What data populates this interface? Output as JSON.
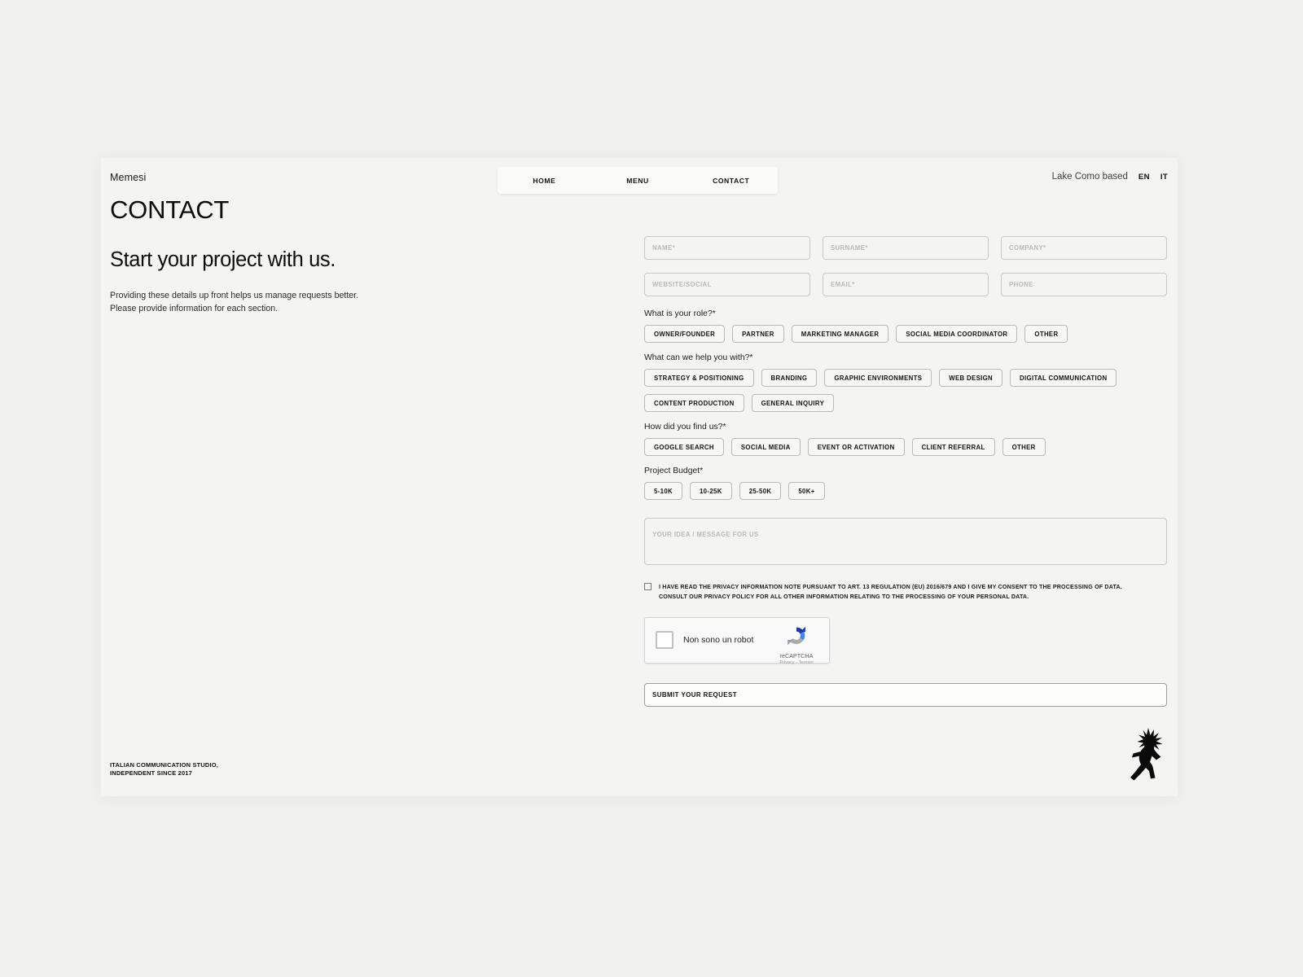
{
  "header": {
    "brand": "Memesi",
    "nav": [
      {
        "label": "HOME"
      },
      {
        "label": "MENU"
      },
      {
        "label": "CONTACT"
      }
    ],
    "location": "Lake Como based",
    "lang_en": "EN",
    "lang_it": "IT"
  },
  "hero": {
    "page_title": "CONTACT",
    "headline": "Start your project with us.",
    "sub_line_1": "Providing these details up front helps us manage requests better.",
    "sub_line_2": "Please provide information for each section."
  },
  "form": {
    "fields_row_1": [
      {
        "placeholder": "NAME*",
        "value": ""
      },
      {
        "placeholder": "SURNAME*",
        "value": ""
      },
      {
        "placeholder": "COMPANY*",
        "value": ""
      }
    ],
    "fields_row_2": [
      {
        "placeholder": "WEBSITE/SOCIAL",
        "value": ""
      },
      {
        "placeholder": "EMAIL*",
        "value": ""
      },
      {
        "placeholder": "PHONE",
        "value": ""
      }
    ],
    "role": {
      "label": "What is your role?*",
      "options": [
        "OWNER/FOUNDER",
        "PARTNER",
        "MARKETING MANAGER",
        "SOCIAL MEDIA COORDINATOR",
        "OTHER"
      ]
    },
    "help": {
      "label": "What can we help you with?*",
      "options": [
        "STRATEGY & POSITIONING",
        "BRANDING",
        "GRAPHIC ENVIRONMENTS",
        "WEB DESIGN",
        "DIGITAL COMMUNICATION",
        "CONTENT PRODUCTION",
        "GENERAL INQUIRY"
      ]
    },
    "source": {
      "label": "How did you find us?*",
      "options": [
        "GOOGLE SEARCH",
        "SOCIAL MEDIA",
        "EVENT OR ACTIVATION",
        "CLIENT REFERRAL",
        "OTHER"
      ]
    },
    "budget": {
      "label": "Project Budget*",
      "options": [
        "5-10K",
        "10-25K",
        "25-50K",
        "50K+"
      ]
    },
    "message": {
      "placeholder": "YOUR IDEA / MESSAGE FOR US",
      "value": ""
    },
    "consent": {
      "line_1": "I HAVE READ THE PRIVACY INFORMATION NOTE PURSUANT TO ART. 13 REGULATION (EU) 2016/679 AND I GIVE MY CONSENT TO THE PROCESSING OF DATA.",
      "line_2": "CONSULT OUR PRIVACY POLICY FOR ALL OTHER INFORMATION RELATING TO THE PROCESSING OF YOUR PERSONAL DATA.",
      "checked": false
    },
    "captcha": {
      "label": "Non sono un robot",
      "brand": "reCAPTCHA",
      "links": "Privacy - Termini"
    },
    "submit_label": "SUBMIT YOUR REQUEST"
  },
  "footer": {
    "line_1": "ITALIAN COMMUNICATION STUDIO,",
    "line_2": "INDEPENDENT SINCE 2017"
  },
  "colors": {
    "page_bg": "#f0f0ee",
    "canvas_bg": "#f4f4f2",
    "text": "#111111",
    "placeholder": "#b9b9b6",
    "border": "#c9c9c6",
    "captcha_blue": "#1c64c4"
  }
}
